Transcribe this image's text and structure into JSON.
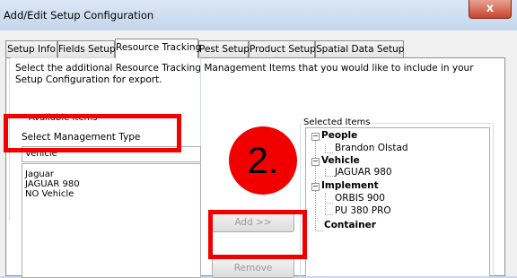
{
  "window": {
    "title": "Add/Edit Setup Configuration",
    "close_glyph": "x"
  },
  "tabs": [
    {
      "label": "Setup Info"
    },
    {
      "label": "Fields Setup"
    },
    {
      "label": "Resource Tracking"
    },
    {
      "label": "Pest Setup"
    },
    {
      "label": "Product Setup"
    },
    {
      "label": "Spatial Data Setup"
    }
  ],
  "active_tab": "Resource Tracking",
  "description": "Select the additional Resource Tracking Management Items that you would like to include in your Setup Configuration for export.",
  "available": {
    "group_label": "Available Items",
    "type_label": "Select Management Type",
    "type_value": "Vehicle",
    "items": [
      "Jaguar",
      "JAGUAR 980",
      "NO Vehicle"
    ]
  },
  "buttons": {
    "add": "Add >>",
    "remove": "Remove"
  },
  "selected": {
    "group_label": "Selected Items",
    "tree": {
      "people": "People",
      "people_children": [
        "Brandon Olstad"
      ],
      "vehicle": "Vehicle",
      "vehicle_children": [
        "JAGUAR 980"
      ],
      "implement": "Implement",
      "implement_children": [
        "ORBIS 900",
        "PU 380 PRO"
      ],
      "container": "Container"
    }
  },
  "annotation": {
    "step_label": "2.",
    "color": "#f20000"
  }
}
